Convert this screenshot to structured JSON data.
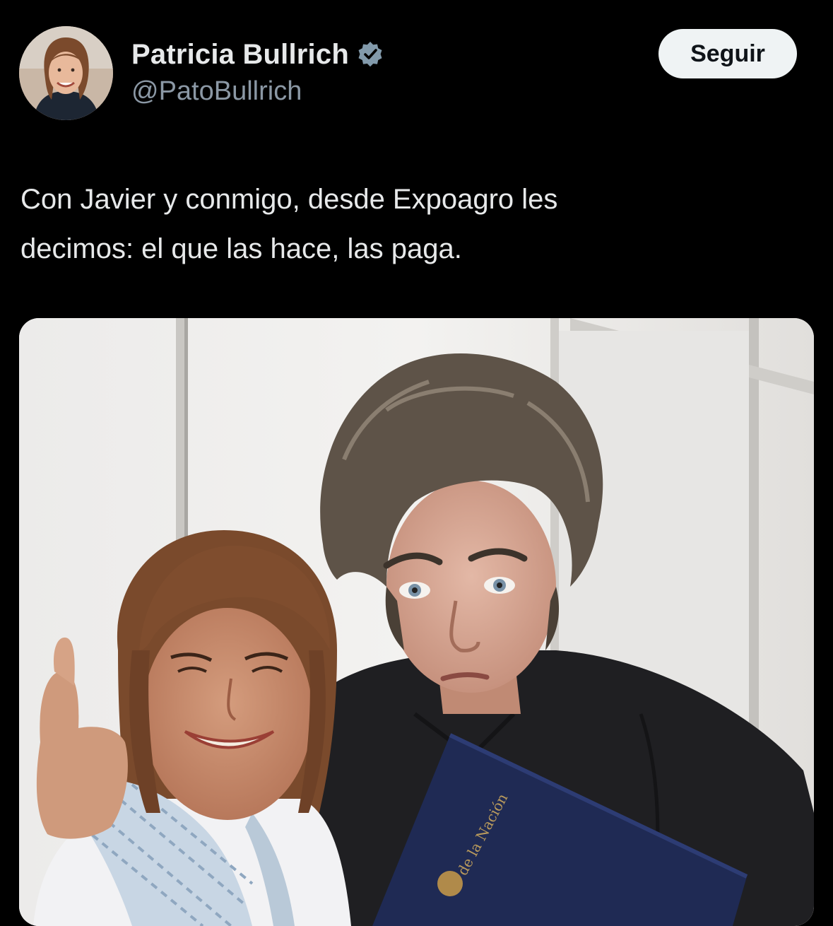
{
  "tweet": {
    "author": {
      "display_name": "Patricia Bullrich",
      "handle": "@PatoBullrich",
      "verified_icon": "verified-badge-icon",
      "avatar": "avatar"
    },
    "follow_label": "Seguir",
    "text_lines": [
      "Con Javier y conmigo, desde Expoagro les",
      "decimos: el que las hace, las paga."
    ],
    "media": {
      "type": "photo",
      "folder_text": "de la Nación"
    }
  },
  "colors": {
    "background": "#000000",
    "primary_text": "#e7e9ea",
    "secondary_text": "#8b98a5",
    "button_bg": "#eff3f4",
    "button_text": "#0f1419",
    "verified_badge": "#829aab"
  }
}
